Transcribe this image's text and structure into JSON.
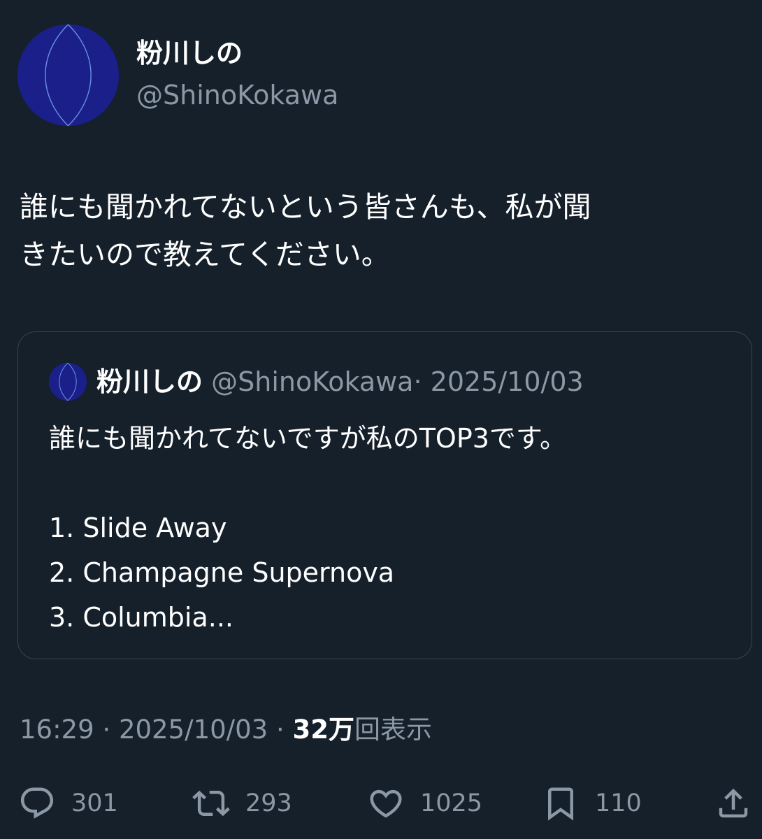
{
  "author": {
    "display_name": "粉川しの",
    "handle": "@ShinoKokawa"
  },
  "tweet": {
    "lines": [
      "誰にも聞かれてないという皆さんも、私が聞",
      "きたいので教えてください。"
    ]
  },
  "quote": {
    "display_name": "粉川しの",
    "handle": "@ShinoKokawa",
    "separator": "·",
    "date": "2025/10/03",
    "lines": [
      "誰にも聞かれてないですが私のTOP3です。",
      "1. Slide Away",
      "2. Champagne Supernova",
      "3. Columbia..."
    ]
  },
  "meta": {
    "time": "16:29",
    "separator": "·",
    "date": "2025/10/03",
    "views_count": "32万",
    "views_label": "回表示"
  },
  "actions": {
    "reply": {
      "icon": "reply-icon",
      "count": "301"
    },
    "repost": {
      "icon": "repost-icon",
      "count": "293"
    },
    "like": {
      "icon": "heart-icon",
      "count": "1025"
    },
    "bookmark": {
      "icon": "bookmark-icon",
      "count": "110"
    },
    "share": {
      "icon": "share-icon"
    }
  },
  "colors": {
    "background": "#15202b",
    "text_primary": "#ffffff",
    "text_secondary": "#8b98a5",
    "border": "#38444d",
    "avatar_blue": "#1a1f8a"
  }
}
